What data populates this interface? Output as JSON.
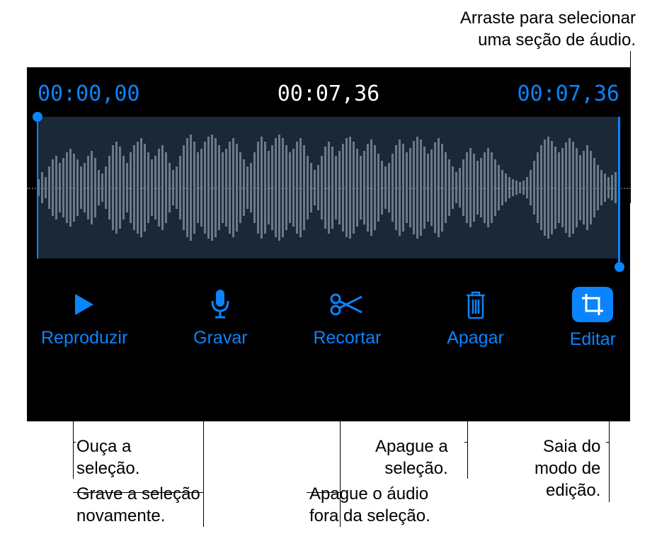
{
  "annotations": {
    "top": "Arraste para selecionar\numa seção de áudio.",
    "play": "Ouça a\nseleção.",
    "record": "Grave a seleção\nnovamente.",
    "trim": "Apague o áudio\nfora da seleção.",
    "delete": "Apague a\nseleção.",
    "edit": "Saia do\nmodo de\nedição."
  },
  "timestamps": {
    "start": "00:00,00",
    "current": "00:07,36",
    "end": "00:07,36"
  },
  "toolbar": {
    "play": "Reproduzir",
    "record": "Gravar",
    "trim": "Recortar",
    "delete": "Apagar",
    "edit": "Editar"
  }
}
